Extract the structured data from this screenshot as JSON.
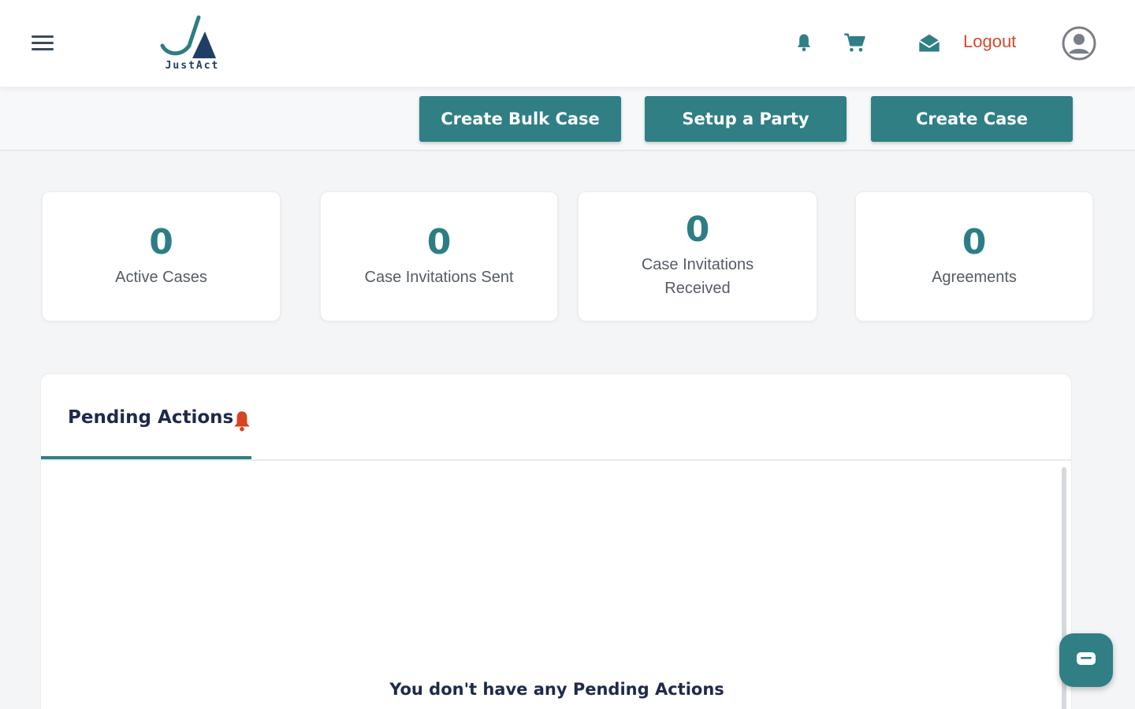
{
  "header": {
    "brand": "JustAct",
    "logout_label": "Logout",
    "icons": [
      "menu-icon",
      "bell-icon",
      "cart-icon",
      "mail-open-icon",
      "user-avatar-icon"
    ]
  },
  "actions": {
    "create_bulk_case": "Create Bulk Case",
    "setup_party": "Setup a Party",
    "create_case": "Create Case"
  },
  "stats": [
    {
      "value": "0",
      "label": "Active Cases"
    },
    {
      "value": "0",
      "label": "Case Invitations Sent"
    },
    {
      "value": "0",
      "label": "Case Invitations Received"
    },
    {
      "value": "0",
      "label": "Agreements"
    }
  ],
  "pending": {
    "tab_label": "Pending Actions",
    "empty_message": "You don't have any Pending Actions"
  },
  "colors": {
    "primary": "#2f7f85",
    "logout": "#d44a2a",
    "alert_bell": "#d9431e",
    "navy": "#1f2a4a"
  }
}
